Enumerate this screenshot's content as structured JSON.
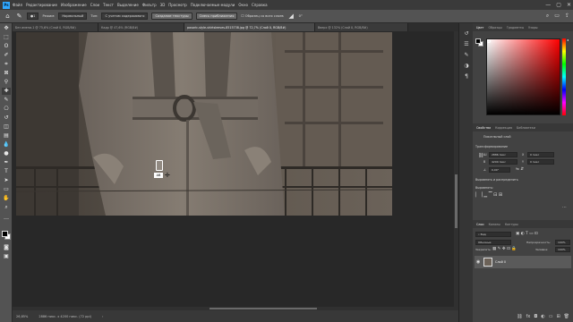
{
  "app": {
    "logo": "Ps"
  },
  "menu": [
    "Файл",
    "Редактирование",
    "Изображение",
    "Слои",
    "Текст",
    "Выделение",
    "Фильтр",
    "3D",
    "Просмотр",
    "Подключаемые модули",
    "Окно",
    "Справка"
  ],
  "window_controls": {
    "minimize": "—",
    "maximize": "▢",
    "close": "✕"
  },
  "options_bar": {
    "size_value": "1",
    "mode_label": "Режим:",
    "mode_value": "Нормальный",
    "type_label": "Тип:",
    "type_value": "С учетом содержимого",
    "create_texture": "Создание текстуры",
    "approx_match": "Смесь приближения",
    "sample_all": "Образец со всех слоев",
    "angle_value": "0°"
  },
  "tabs": [
    "Без имени-1 @ 75,6% (Слой 0, RGB/8#)",
    "Кадр @ 47,6% (RGB/8#)",
    "posaric-style-shirtsleeves-8515738.jpg @ 72,7% (Слой 0, RGB/8#)",
    "Вверх @ 132% (Слой 0, RGB/8#)"
  ],
  "status_bar": {
    "zoom": "26,85%",
    "dims": "2886 пикс. x 4200 пикс. (72 ppi)"
  },
  "color_panel": {
    "tabs": [
      "Цвет",
      "Образцы",
      "Градиенты",
      "Узоры"
    ]
  },
  "properties_panel": {
    "tabs": [
      "Свойства",
      "Коррекция",
      "Библиотеки"
    ],
    "layer_kind": "Пиксельный слой",
    "transform_label": "Трансформирование",
    "w_label": "Ш",
    "w_value": "2886 пикс",
    "h_label": "В",
    "h_value": "4200 пикс",
    "x_label": "X",
    "x_value": "0 пикс",
    "y_label": "Y",
    "y_value": "0 пикс",
    "angle_value": "0,00°",
    "align_label": "Выровнять и распределить",
    "align_sub": "Выровнять:"
  },
  "layers_panel": {
    "tabs": [
      "Слои",
      "Каналы",
      "Контуры"
    ],
    "search_placeholder": "Вид",
    "blend_mode": "Обычные",
    "opacity_label": "Непрозрачность:",
    "opacity_value": "100%",
    "lock_label": "Закрепить:",
    "fill_label": "Заливка:",
    "fill_value": "100%",
    "layer_name": "Слой 0"
  },
  "colors": {
    "accent": "#31a8ff",
    "panel": "#424242",
    "canvas_bg": "#282828"
  }
}
